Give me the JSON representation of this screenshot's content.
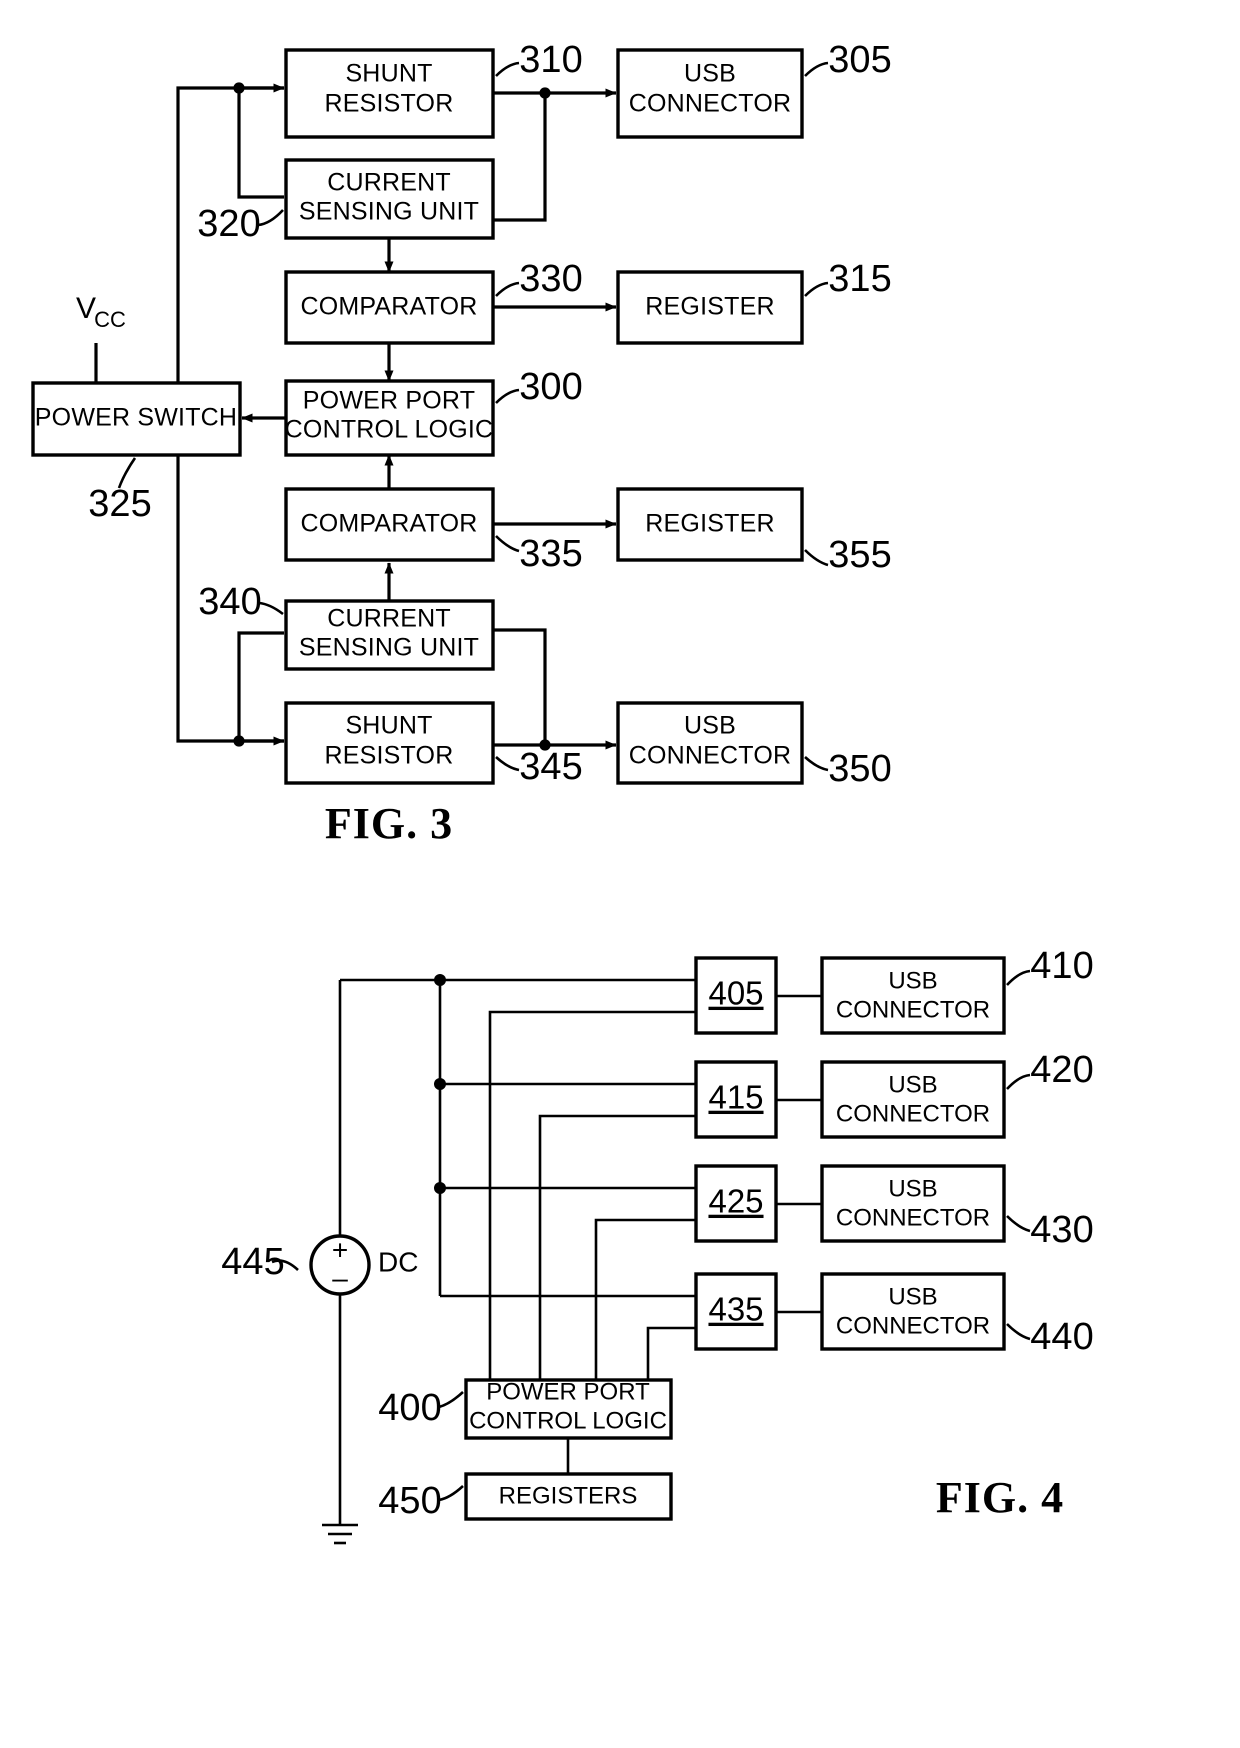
{
  "document": {
    "type": "patent-drawing-sheet",
    "figures": [
      "FIG. 3",
      "FIG. 4"
    ]
  },
  "fig3": {
    "caption": "FIG. 3",
    "blocks": {
      "shunt_top": {
        "line1": "SHUNT",
        "line2": "RESISTOR"
      },
      "usb_top": {
        "line1": "USB",
        "line2": "CONNECTOR"
      },
      "csu_top": {
        "line1": "CURRENT",
        "line2": "SENSING UNIT"
      },
      "comparator_top": {
        "line1": "COMPARATOR"
      },
      "register_top": {
        "line1": "REGISTER"
      },
      "ppcl": {
        "line1": "POWER PORT",
        "line2": "CONTROL LOGIC"
      },
      "power_switch": {
        "line1": "POWER SWITCH"
      },
      "comparator_bot": {
        "line1": "COMPARATOR"
      },
      "register_bot": {
        "line1": "REGISTER"
      },
      "csu_bot": {
        "line1": "CURRENT",
        "line2": "SENSING UNIT"
      },
      "shunt_bot": {
        "line1": "SHUNT",
        "line2": "RESISTOR"
      },
      "usb_bot": {
        "line1": "USB",
        "line2": "CONNECTOR"
      }
    },
    "labels": {
      "vcc": "V",
      "vcc_sub": "CC",
      "ref_310": "310",
      "ref_305": "305",
      "ref_320": "320",
      "ref_330": "330",
      "ref_315": "315",
      "ref_300": "300",
      "ref_325": "325",
      "ref_335": "335",
      "ref_355": "355",
      "ref_340": "340",
      "ref_345": "345",
      "ref_350": "350"
    }
  },
  "fig4": {
    "caption": "FIG. 4",
    "blocks": {
      "sw405": {
        "num": "405"
      },
      "sw415": {
        "num": "415"
      },
      "sw425": {
        "num": "425"
      },
      "sw435": {
        "num": "435"
      },
      "usb410": {
        "line1": "USB",
        "line2": "CONNECTOR"
      },
      "usb420": {
        "line1": "USB",
        "line2": "CONNECTOR"
      },
      "usb430": {
        "line1": "USB",
        "line2": "CONNECTOR"
      },
      "usb440": {
        "line1": "USB",
        "line2": "CONNECTOR"
      },
      "ppcl": {
        "line1": "POWER PORT",
        "line2": "CONTROL LOGIC"
      },
      "registers": {
        "line1": "REGISTERS"
      }
    },
    "labels": {
      "ref_410": "410",
      "ref_420": "420",
      "ref_430": "430",
      "ref_440": "440",
      "ref_445": "445",
      "ref_400": "400",
      "ref_450": "450",
      "dc": "DC",
      "plus": "+",
      "minus": "–"
    }
  }
}
